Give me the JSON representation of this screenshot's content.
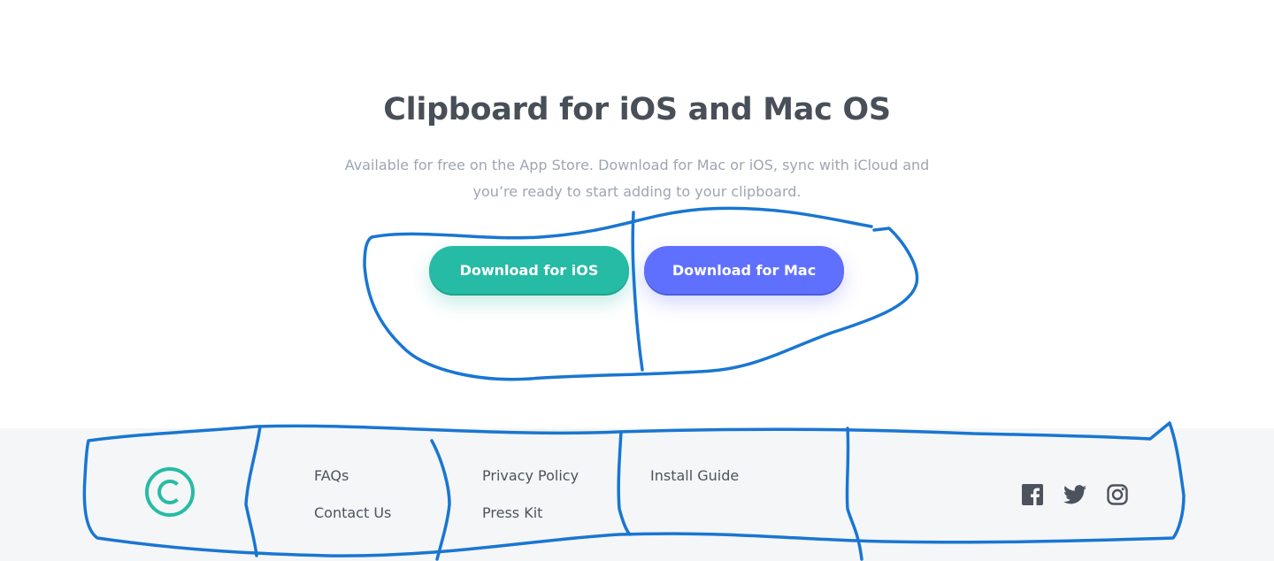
{
  "hero": {
    "title": "Clipboard for iOS and Mac OS",
    "description_line1": "Available for free on the App Store. Download for Mac or iOS, sync with iCloud and",
    "description_line2": "you’re ready to start adding to your clipboard.",
    "buttons": [
      {
        "label": "Download for iOS",
        "color": "#26bba4"
      },
      {
        "label": "Download for Mac",
        "color": "#6070fe"
      }
    ]
  },
  "footer": {
    "logo_icon": "copyright-circle-logo",
    "logo_color": "#26bba4",
    "links_col1": [
      "FAQs",
      "Contact Us"
    ],
    "links_col2": [
      "Privacy Policy",
      "Press Kit"
    ],
    "links_col3": [
      "Install Guide"
    ],
    "social_icons": [
      "facebook-icon",
      "twitter-icon",
      "instagram-icon"
    ]
  },
  "annotation_color": "#1976d2"
}
